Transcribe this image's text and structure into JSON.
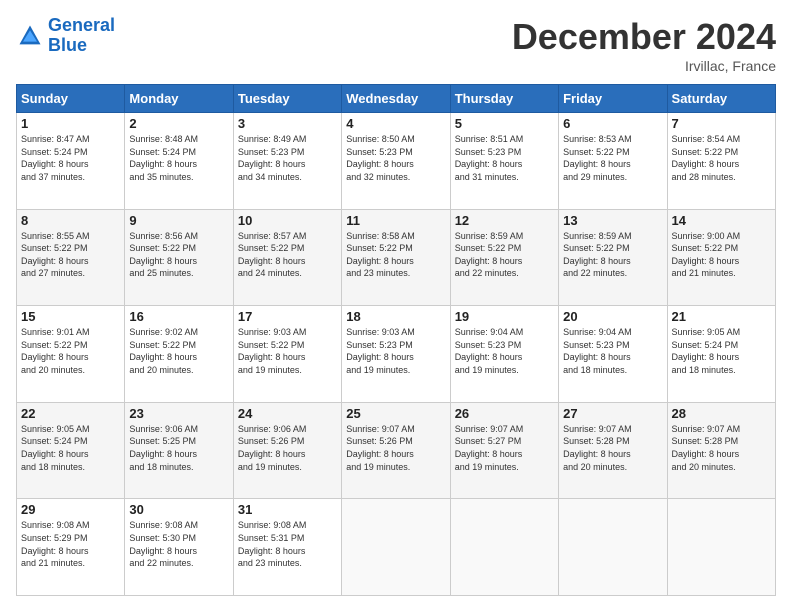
{
  "logo": {
    "line1": "General",
    "line2": "Blue"
  },
  "title": "December 2024",
  "location": "Irvillac, France",
  "weekdays": [
    "Sunday",
    "Monday",
    "Tuesday",
    "Wednesday",
    "Thursday",
    "Friday",
    "Saturday"
  ],
  "weeks": [
    [
      {
        "day": "1",
        "content": "Sunrise: 8:47 AM\nSunset: 5:24 PM\nDaylight: 8 hours\nand 37 minutes."
      },
      {
        "day": "2",
        "content": "Sunrise: 8:48 AM\nSunset: 5:24 PM\nDaylight: 8 hours\nand 35 minutes."
      },
      {
        "day": "3",
        "content": "Sunrise: 8:49 AM\nSunset: 5:23 PM\nDaylight: 8 hours\nand 34 minutes."
      },
      {
        "day": "4",
        "content": "Sunrise: 8:50 AM\nSunset: 5:23 PM\nDaylight: 8 hours\nand 32 minutes."
      },
      {
        "day": "5",
        "content": "Sunrise: 8:51 AM\nSunset: 5:23 PM\nDaylight: 8 hours\nand 31 minutes."
      },
      {
        "day": "6",
        "content": "Sunrise: 8:53 AM\nSunset: 5:22 PM\nDaylight: 8 hours\nand 29 minutes."
      },
      {
        "day": "7",
        "content": "Sunrise: 8:54 AM\nSunset: 5:22 PM\nDaylight: 8 hours\nand 28 minutes."
      }
    ],
    [
      {
        "day": "8",
        "content": "Sunrise: 8:55 AM\nSunset: 5:22 PM\nDaylight: 8 hours\nand 27 minutes."
      },
      {
        "day": "9",
        "content": "Sunrise: 8:56 AM\nSunset: 5:22 PM\nDaylight: 8 hours\nand 25 minutes."
      },
      {
        "day": "10",
        "content": "Sunrise: 8:57 AM\nSunset: 5:22 PM\nDaylight: 8 hours\nand 24 minutes."
      },
      {
        "day": "11",
        "content": "Sunrise: 8:58 AM\nSunset: 5:22 PM\nDaylight: 8 hours\nand 23 minutes."
      },
      {
        "day": "12",
        "content": "Sunrise: 8:59 AM\nSunset: 5:22 PM\nDaylight: 8 hours\nand 22 minutes."
      },
      {
        "day": "13",
        "content": "Sunrise: 8:59 AM\nSunset: 5:22 PM\nDaylight: 8 hours\nand 22 minutes."
      },
      {
        "day": "14",
        "content": "Sunrise: 9:00 AM\nSunset: 5:22 PM\nDaylight: 8 hours\nand 21 minutes."
      }
    ],
    [
      {
        "day": "15",
        "content": "Sunrise: 9:01 AM\nSunset: 5:22 PM\nDaylight: 8 hours\nand 20 minutes."
      },
      {
        "day": "16",
        "content": "Sunrise: 9:02 AM\nSunset: 5:22 PM\nDaylight: 8 hours\nand 20 minutes."
      },
      {
        "day": "17",
        "content": "Sunrise: 9:03 AM\nSunset: 5:22 PM\nDaylight: 8 hours\nand 19 minutes."
      },
      {
        "day": "18",
        "content": "Sunrise: 9:03 AM\nSunset: 5:23 PM\nDaylight: 8 hours\nand 19 minutes."
      },
      {
        "day": "19",
        "content": "Sunrise: 9:04 AM\nSunset: 5:23 PM\nDaylight: 8 hours\nand 19 minutes."
      },
      {
        "day": "20",
        "content": "Sunrise: 9:04 AM\nSunset: 5:23 PM\nDaylight: 8 hours\nand 18 minutes."
      },
      {
        "day": "21",
        "content": "Sunrise: 9:05 AM\nSunset: 5:24 PM\nDaylight: 8 hours\nand 18 minutes."
      }
    ],
    [
      {
        "day": "22",
        "content": "Sunrise: 9:05 AM\nSunset: 5:24 PM\nDaylight: 8 hours\nand 18 minutes."
      },
      {
        "day": "23",
        "content": "Sunrise: 9:06 AM\nSunset: 5:25 PM\nDaylight: 8 hours\nand 18 minutes."
      },
      {
        "day": "24",
        "content": "Sunrise: 9:06 AM\nSunset: 5:26 PM\nDaylight: 8 hours\nand 19 minutes."
      },
      {
        "day": "25",
        "content": "Sunrise: 9:07 AM\nSunset: 5:26 PM\nDaylight: 8 hours\nand 19 minutes."
      },
      {
        "day": "26",
        "content": "Sunrise: 9:07 AM\nSunset: 5:27 PM\nDaylight: 8 hours\nand 19 minutes."
      },
      {
        "day": "27",
        "content": "Sunrise: 9:07 AM\nSunset: 5:28 PM\nDaylight: 8 hours\nand 20 minutes."
      },
      {
        "day": "28",
        "content": "Sunrise: 9:07 AM\nSunset: 5:28 PM\nDaylight: 8 hours\nand 20 minutes."
      }
    ],
    [
      {
        "day": "29",
        "content": "Sunrise: 9:08 AM\nSunset: 5:29 PM\nDaylight: 8 hours\nand 21 minutes."
      },
      {
        "day": "30",
        "content": "Sunrise: 9:08 AM\nSunset: 5:30 PM\nDaylight: 8 hours\nand 22 minutes."
      },
      {
        "day": "31",
        "content": "Sunrise: 9:08 AM\nSunset: 5:31 PM\nDaylight: 8 hours\nand 23 minutes."
      },
      {
        "day": "",
        "content": ""
      },
      {
        "day": "",
        "content": ""
      },
      {
        "day": "",
        "content": ""
      },
      {
        "day": "",
        "content": ""
      }
    ]
  ]
}
